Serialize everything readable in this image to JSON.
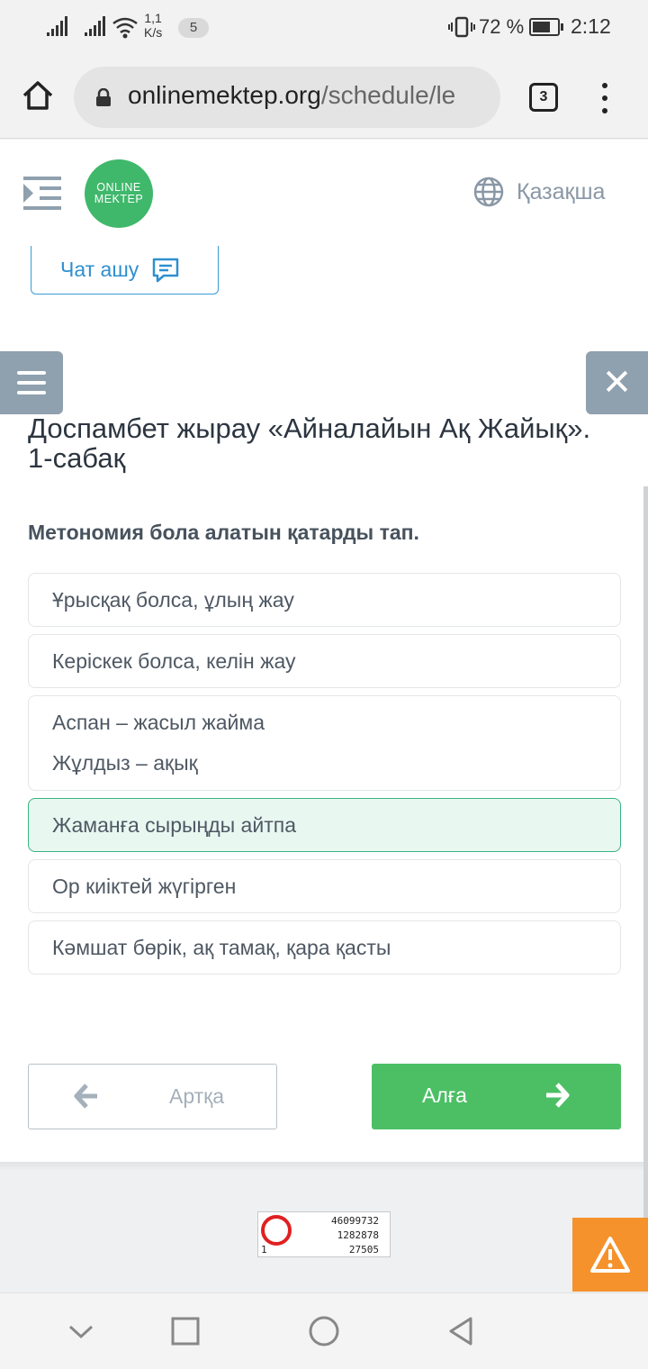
{
  "status_bar": {
    "speed_value": "1,1",
    "speed_unit": "K/s",
    "notif_count": "5",
    "battery_percent": "72 %",
    "battery_level": 0.72,
    "time": "2:12"
  },
  "browser": {
    "url_domain": "onlinemektep.org",
    "url_path": "/schedule/le",
    "tab_count": "3"
  },
  "header": {
    "logo_line1": "ONLINE",
    "logo_line2": "MEKTEP",
    "language": "Қазақша",
    "chat_label": "Чат ашу"
  },
  "lesson": {
    "title": "Доспамбет жырау «Айналайын Ақ Жайық». 1-сабақ",
    "question": "Метономия бола алатын қатарды тап.",
    "answers": [
      {
        "lines": [
          "Ұрысқақ болса, ұлың жау"
        ],
        "selected": false
      },
      {
        "lines": [
          "Керіскек болса, келін жау"
        ],
        "selected": false
      },
      {
        "lines": [
          "Аспан – жасыл жайма",
          "Жұлдыз – ақық"
        ],
        "selected": false
      },
      {
        "lines": [
          "Жаманға сырыңды айтпа"
        ],
        "selected": true
      },
      {
        "lines": [
          "Ор киіктей жүгірген"
        ],
        "selected": false
      },
      {
        "lines": [
          "Кәмшат бөрік, ақ тамақ, қара қасты"
        ],
        "selected": false
      }
    ],
    "back_label": "Артқа",
    "next_label": "Алға"
  },
  "counter": {
    "row1": "46099732",
    "row2": "1282878",
    "row3": "27505",
    "row3_left": "1"
  },
  "colors": {
    "accent_green": "#4cbf65",
    "selected_border": "#38b483",
    "link_blue": "#2f8fd0",
    "report_orange": "#f5922b"
  }
}
